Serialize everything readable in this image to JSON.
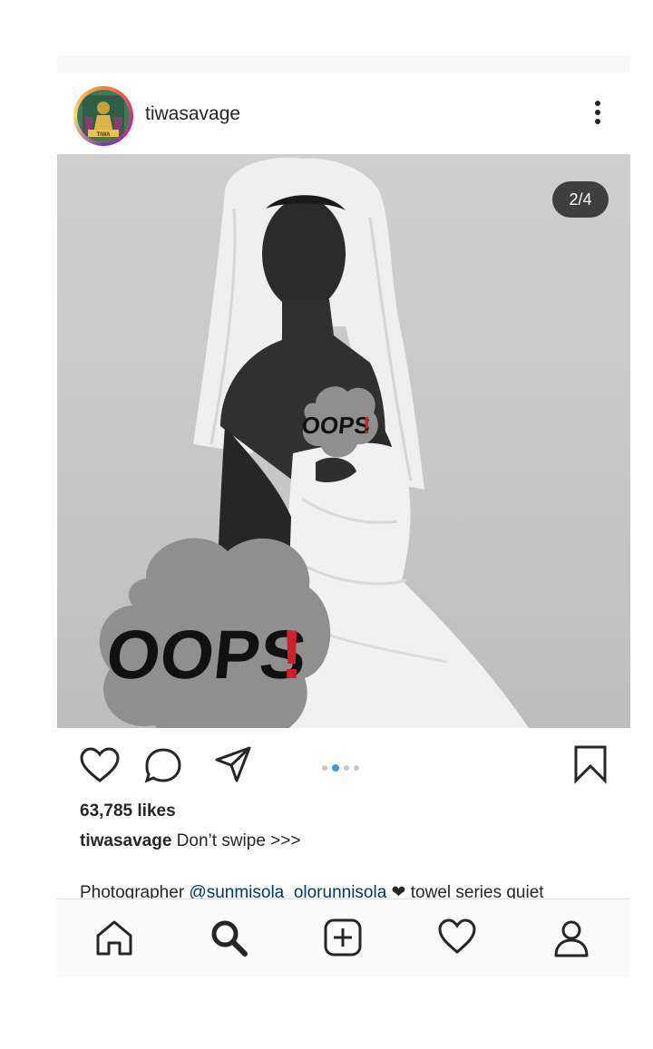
{
  "post": {
    "username": "tiwasavage",
    "avatar_text": "TIWA",
    "counter": "2/4",
    "sticker_text": "OOPS",
    "sticker_mark": "!",
    "likes": "63,785 likes",
    "caption_user": "tiwasavage",
    "caption_text": " Don’t swipe >>>",
    "caption2_prefix": "Photographer ",
    "caption2_mention": "@sunmisola_olorunnisola",
    "caption2_heart": " ❤ ",
    "caption2_suffix": "towel series quiet",
    "carousel_active_index": 2,
    "carousel_total": 4
  },
  "icons": {
    "more": "more-vertical-icon",
    "like": "heart-icon",
    "comment": "comment-icon",
    "share": "send-icon",
    "save": "bookmark-icon",
    "nav": [
      "home-icon",
      "search-icon",
      "add-post-icon",
      "activity-heart-icon",
      "profile-icon"
    ]
  },
  "colors": {
    "active_dot": "#3897f0",
    "text": "#262626",
    "mention": "#003569",
    "sticker_grey": "#8f8f8f",
    "sticker_red": "#d0202e"
  }
}
